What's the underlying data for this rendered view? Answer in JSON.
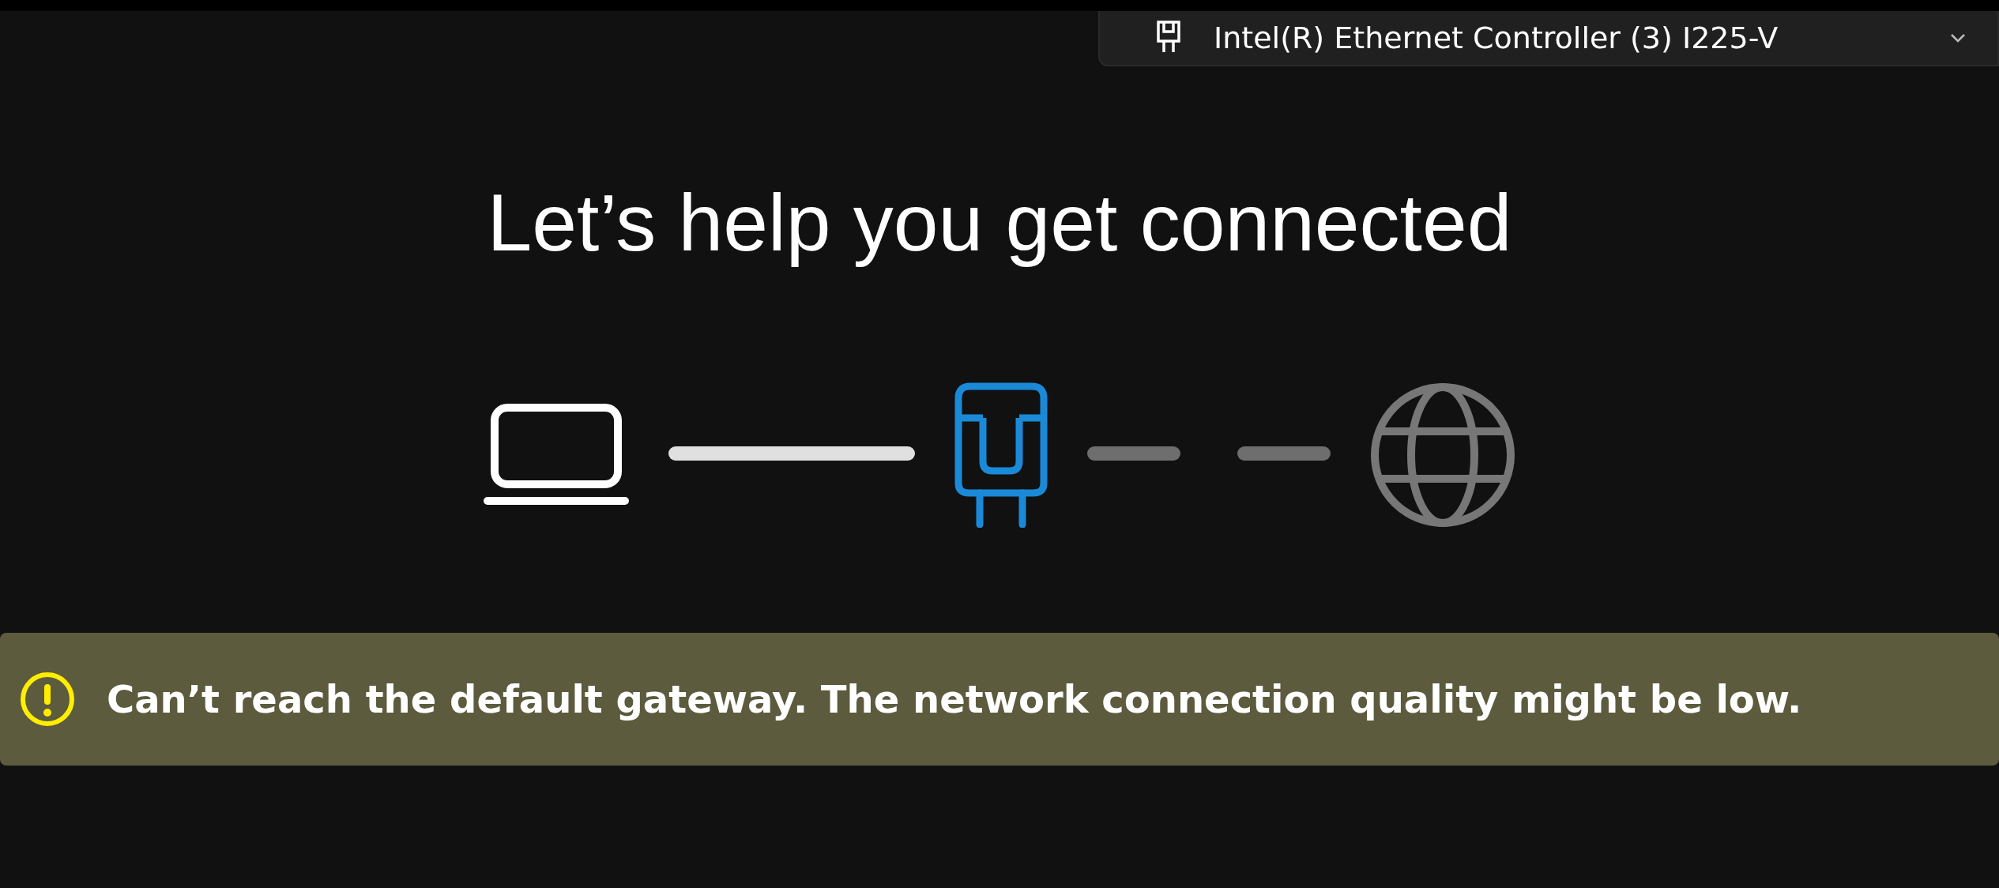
{
  "adapter_dropdown": {
    "value": "Intel(R) Ethernet Controller (3) I225-V"
  },
  "title": "Let’s help you get connected",
  "diagram": {
    "nodes": [
      {
        "kind": "computer",
        "current": false,
        "reachable": true
      },
      {
        "kind": "adapter",
        "current": true,
        "reachable": true
      },
      {
        "kind": "internet",
        "current": false,
        "reachable": false
      }
    ],
    "links": [
      {
        "connected": true
      },
      {
        "connected": false
      }
    ]
  },
  "banner": {
    "kind": "warning",
    "message": "Can’t reach the default gateway. The network connection quality might be low."
  }
}
